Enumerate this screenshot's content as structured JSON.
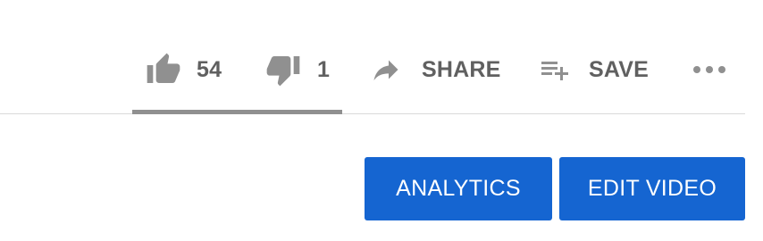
{
  "actions": {
    "like_count": "54",
    "dislike_count": "1",
    "share_label": "SHARE",
    "save_label": "SAVE"
  },
  "sentiment": {
    "like_fraction": 0.98
  },
  "buttons": {
    "analytics_label": "ANALYTICS",
    "edit_video_label": "EDIT VIDEO"
  },
  "colors": {
    "icon_gray": "#606060",
    "sentiment_bar": "#909090",
    "primary_button": "#1565d1"
  },
  "icons": [
    "thumb-up-icon",
    "thumb-down-icon",
    "share-arrow-icon",
    "playlist-add-icon",
    "more-horizontal-icon"
  ]
}
